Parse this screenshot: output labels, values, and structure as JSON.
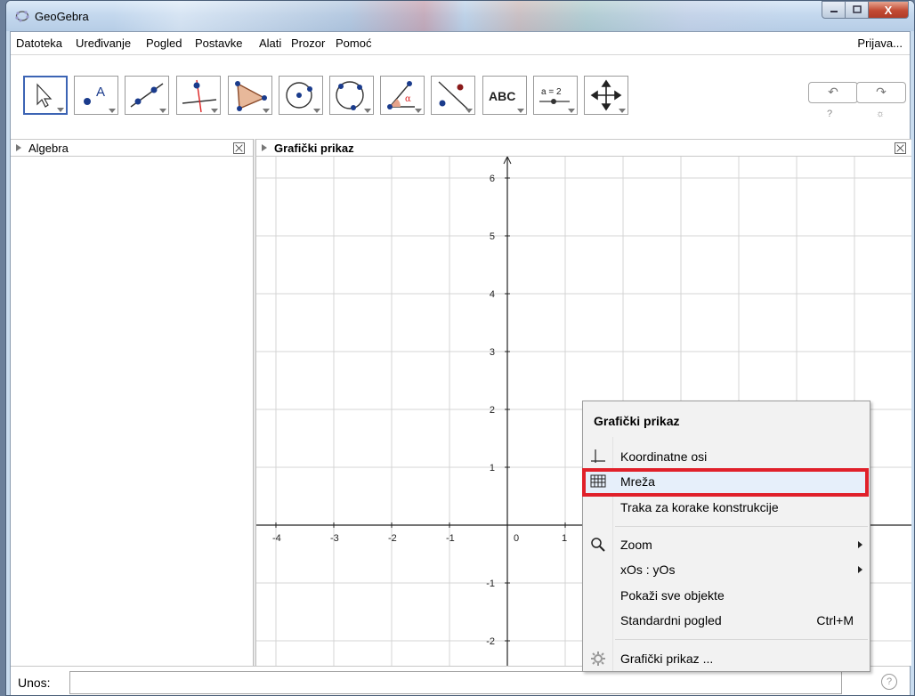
{
  "window": {
    "title": "GeoGebra",
    "close_glyph": "X"
  },
  "menubar": {
    "items": [
      "Datoteka",
      "Uređivanje",
      "Pogled",
      "Postavke",
      "Alati",
      "Prozor",
      "Pomoć"
    ],
    "login": "Prijava..."
  },
  "toolbar": {
    "tools": [
      "move-tool",
      "point-tool",
      "line-tool",
      "perpendicular-line-tool",
      "polygon-tool",
      "circle-center-point-tool",
      "circle-three-points-tool",
      "angle-tool",
      "reflect-tool",
      "text-tool",
      "slider-tool",
      "move-graphics-view-tool"
    ],
    "text_tool_label": "ABC",
    "slider_tool_label": "a = 2",
    "undo_glyph": "↶",
    "redo_glyph": "↷",
    "help_glyph": "?",
    "settings_glyph": "☼"
  },
  "algebra_panel": {
    "title": "Algebra"
  },
  "graphics_panel": {
    "title": "Grafički prikaz",
    "x_ticks": [
      "-4",
      "-3",
      "-2",
      "-1",
      "0",
      "1"
    ],
    "y_ticks": [
      "6",
      "5",
      "4",
      "3",
      "2",
      "1",
      "-1",
      "-2"
    ]
  },
  "context_menu": {
    "title": "Grafički prikaz",
    "items": {
      "axes": "Koordinatne osi",
      "grid": "Mreža",
      "nav_bar": "Traka za korake konstrukcije",
      "zoom": "Zoom",
      "ratio": "xOs : yOs",
      "show_all": "Pokaži sve objekte",
      "standard_view": "Standardni pogled",
      "standard_view_shortcut": "Ctrl+M",
      "settings": "Grafički prikaz ..."
    }
  },
  "input_bar": {
    "label": "Unos:",
    "value": "",
    "help_glyph": "?"
  }
}
